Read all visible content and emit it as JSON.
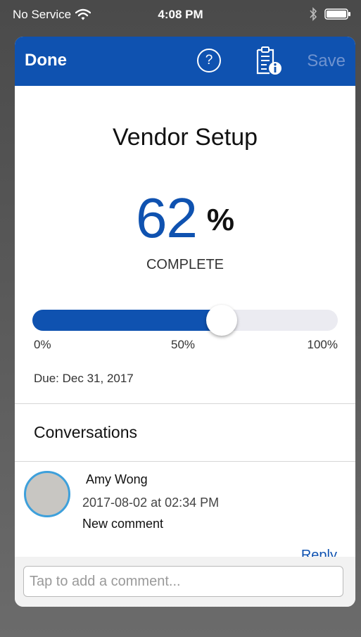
{
  "status_bar": {
    "carrier": "No Service",
    "time": "4:08 PM"
  },
  "navbar": {
    "done_label": "Done",
    "help_label": "?",
    "save_label": "Save",
    "icons": [
      "help-icon",
      "document-info-icon"
    ]
  },
  "task": {
    "title": "Vendor Setup",
    "percent_value": "62",
    "percent_sign": "%",
    "complete_label": "COMPLETE",
    "progress_fraction": 0.62,
    "ticks": [
      "0%",
      "50%",
      "100%"
    ],
    "due": "Due: Dec 31, 2017"
  },
  "conversations": {
    "title": "Conversations",
    "comments": [
      {
        "author": "Amy Wong",
        "timestamp": "2017-08-02 at 02:34 PM",
        "text": "New comment",
        "reply_label": "Reply"
      }
    ]
  },
  "comment_input": {
    "placeholder": "Tap to add a comment..."
  },
  "colors": {
    "accent": "#0f52b0",
    "avatar_ring": "#3ea0db",
    "save_disabled": "#6f93cf"
  }
}
